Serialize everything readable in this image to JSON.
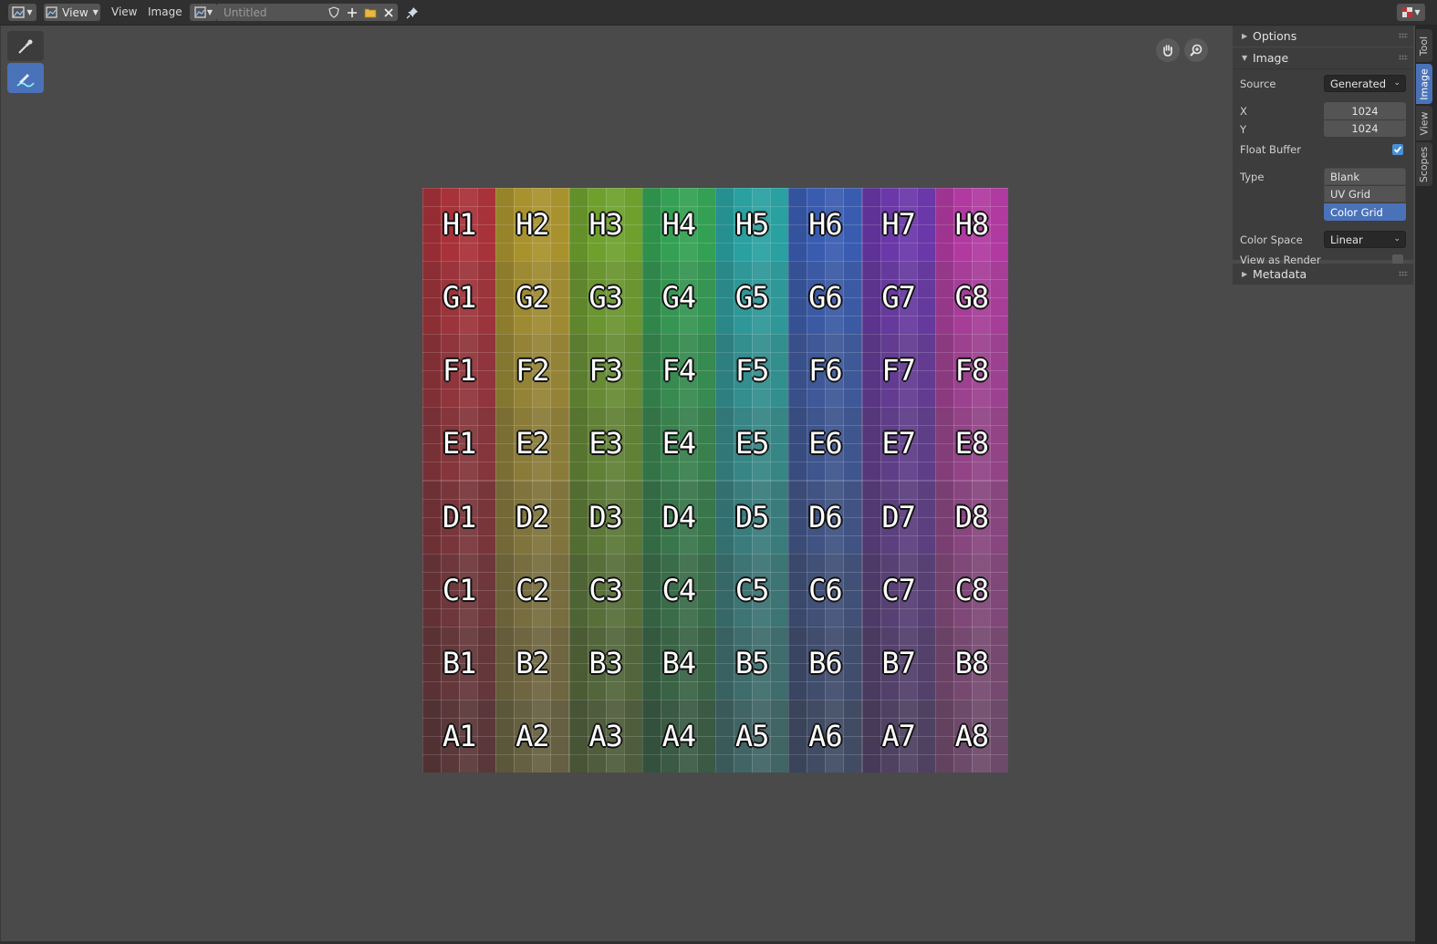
{
  "header": {
    "editor_type_icon": "image-editor-icon",
    "mode_label": "View",
    "menu_view": "View",
    "menu_image": "Image",
    "image_name": "Untitled"
  },
  "toolbar": {
    "tools": [
      {
        "name": "sample-tool",
        "icon": "eyedropper-icon",
        "active": false
      },
      {
        "name": "annotate-tool",
        "icon": "annotate-pen-icon",
        "active": true
      }
    ]
  },
  "image": {
    "rows": [
      "H",
      "G",
      "F",
      "E",
      "D",
      "C",
      "B",
      "A"
    ],
    "columns": [
      "1",
      "2",
      "3",
      "4",
      "5",
      "6",
      "7",
      "8"
    ],
    "column_colors": [
      "#a8323a",
      "#a8922e",
      "#6fa02e",
      "#34a054",
      "#2aa0a0",
      "#3a5cb0",
      "#6a38a8",
      "#b03aa0"
    ]
  },
  "sidebar": {
    "options_label": "Options",
    "image_label": "Image",
    "source_label": "Source",
    "source_value": "Generated",
    "x_label": "X",
    "x_value": "1024",
    "y_label": "Y",
    "y_value": "1024",
    "float_buffer_label": "Float Buffer",
    "float_buffer_checked": true,
    "type_label": "Type",
    "type_options": [
      "Blank",
      "UV Grid",
      "Color Grid"
    ],
    "type_selected": "Color Grid",
    "color_space_label": "Color Space",
    "color_space_value": "Linear",
    "view_as_render_label": "View as Render",
    "view_as_render_checked": false,
    "metadata_label": "Metadata"
  },
  "tabs": [
    {
      "label": "Tool",
      "active": false
    },
    {
      "label": "Image",
      "active": true
    },
    {
      "label": "View",
      "active": false
    },
    {
      "label": "Scopes",
      "active": false
    }
  ],
  "accent_color": "#4a72b8"
}
